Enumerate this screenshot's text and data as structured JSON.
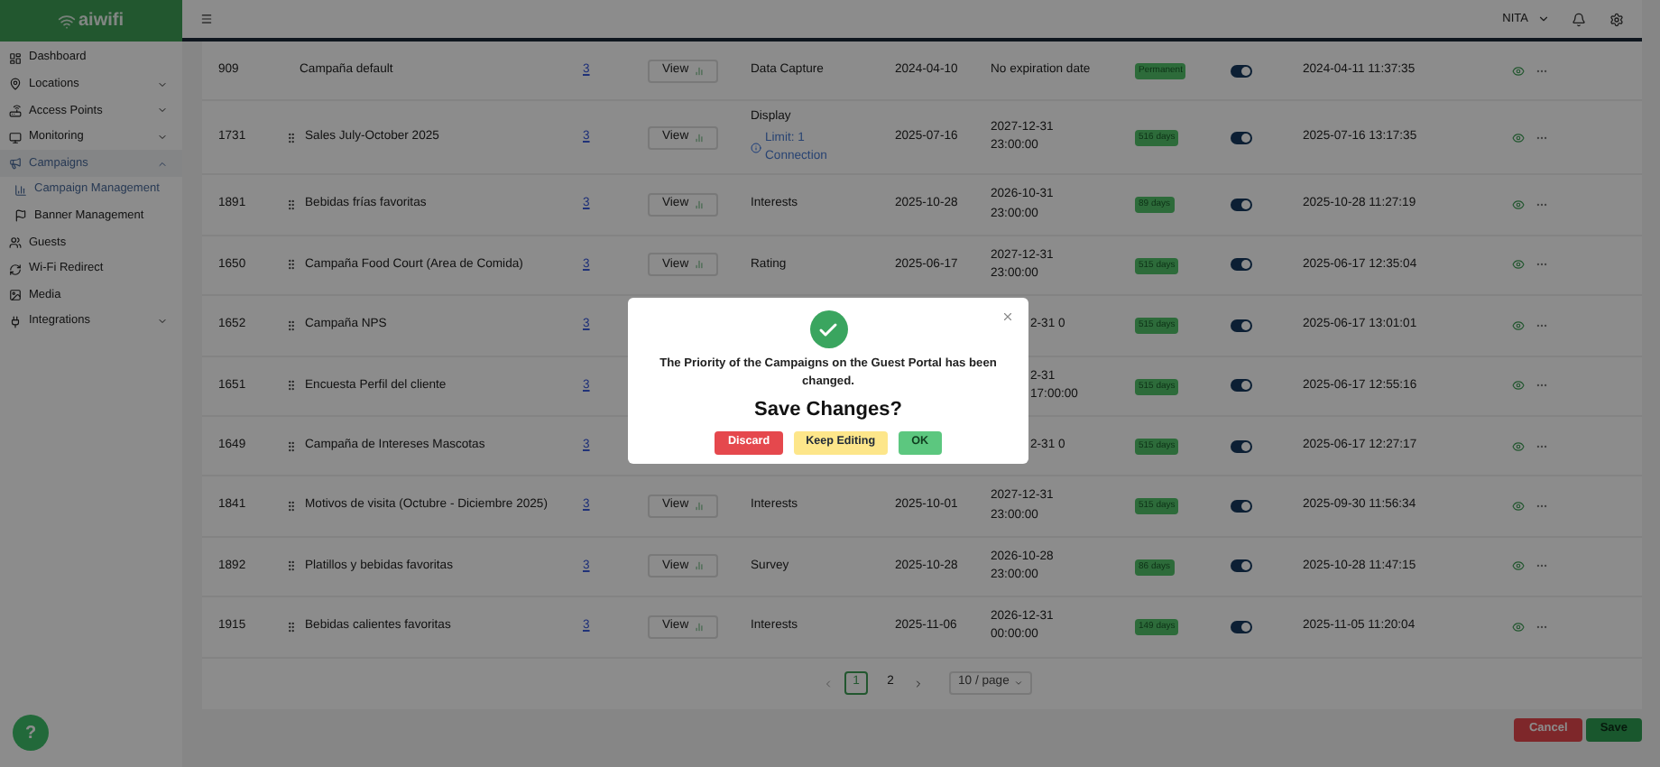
{
  "sidebar": {
    "logo": "aiwifi",
    "items": [
      {
        "label": "Dashboard",
        "kind": "link",
        "selected": false
      },
      {
        "label": "Locations",
        "kind": "group",
        "selected": false,
        "expanded": false
      },
      {
        "label": "Access Points",
        "kind": "group",
        "selected": false,
        "expanded": false
      },
      {
        "label": "Monitoring",
        "kind": "group",
        "selected": false,
        "expanded": false
      },
      {
        "label": "Campaigns",
        "kind": "group",
        "selected": true,
        "expanded": true,
        "children": [
          {
            "label": "Campaign Management",
            "selected": true
          },
          {
            "label": "Banner Management",
            "selected": false
          }
        ]
      },
      {
        "label": "Guests",
        "kind": "link",
        "selected": false
      },
      {
        "label": "Wi-Fi Redirect",
        "kind": "link",
        "selected": false
      },
      {
        "label": "Media",
        "kind": "link",
        "selected": false
      },
      {
        "label": "Integrations",
        "kind": "group",
        "selected": false,
        "expanded": false
      }
    ]
  },
  "header": {
    "user": "NITA"
  },
  "table": {
    "rows": [
      {
        "id": "909",
        "name": "Campaña default",
        "draggable": false,
        "count": "3",
        "view": "View",
        "type": "Data Capture",
        "start": "2024-04-10",
        "end": "No expiration date",
        "badge": "Permanent",
        "on": true,
        "updated": "2024-04-11 11:37:35"
      },
      {
        "id": "1731",
        "name": "Sales July-October 2025",
        "draggable": true,
        "count": "3",
        "view": "View",
        "type": "Display",
        "limit": "Limit: 1 Connection",
        "start": "2025-07-16",
        "end": "2027-12-31 23:00:00",
        "badge": "516 days",
        "on": true,
        "updated": "2025-07-16 13:17:35"
      },
      {
        "id": "1891",
        "name": "Bebidas frías favoritas",
        "draggable": true,
        "count": "3",
        "view": "View",
        "type": "Interests",
        "start": "2025-10-28",
        "end": "2026-10-31 23:00:00",
        "badge": "89 days",
        "on": true,
        "updated": "2025-10-28 11:27:19"
      },
      {
        "id": "1650",
        "name": "Campaña Food Court (Area de Comida)",
        "draggable": true,
        "count": "3",
        "view": "View",
        "type": "Rating",
        "start": "2025-06-17",
        "end": "2027-12-31 23:00:00",
        "badge": "515 days",
        "on": true,
        "updated": "2025-06-17 12:35:04"
      },
      {
        "id": "1652",
        "name": "Campaña NPS",
        "draggable": true,
        "count": "3",
        "end": "2-31 0",
        "badge": "515 days",
        "on": true,
        "updated": "2025-06-17 13:01:01"
      },
      {
        "id": "1651",
        "name": "Encuesta Perfil del cliente",
        "draggable": true,
        "count": "3",
        "end": "2-31 17:00:00",
        "badge": "515 days",
        "on": true,
        "updated": "2025-06-17 12:55:16"
      },
      {
        "id": "1649",
        "name": "Campaña de Intereses Mascotas",
        "draggable": true,
        "count": "3",
        "end": "2-31 0",
        "badge": "515 days",
        "on": true,
        "updated": "2025-06-17 12:27:17"
      },
      {
        "id": "1841",
        "name": "Motivos de visita (Octubre - Diciembre 2025)",
        "draggable": true,
        "count": "3",
        "view": "View",
        "type": "Interests",
        "start": "2025-10-01",
        "end": "2027-12-31 23:00:00",
        "badge": "515 days",
        "on": true,
        "updated": "2025-09-30 11:56:34"
      },
      {
        "id": "1892",
        "name": "Platillos y bebidas favoritas",
        "draggable": true,
        "count": "3",
        "view": "View",
        "type": "Survey",
        "start": "2025-10-28",
        "end": "2026-10-28 23:00:00",
        "badge": "86 days",
        "on": true,
        "updated": "2025-10-28 11:47:15"
      },
      {
        "id": "1915",
        "name": "Bebidas calientes favoritas",
        "draggable": true,
        "count": "3",
        "view": "View",
        "type": "Interests",
        "start": "2025-11-06",
        "end": "2026-12-31 00:00:00",
        "badge": "149 days",
        "on": true,
        "updated": "2025-11-05 11:20:04"
      }
    ]
  },
  "pagination": {
    "pages": [
      {
        "label": "1",
        "selected": true
      },
      {
        "label": "2",
        "selected": false
      }
    ],
    "page_size": "10 / page"
  },
  "footer_buttons": [
    {
      "label": "Cancel",
      "kind": "danger"
    },
    {
      "label": "Save",
      "kind": "primary"
    }
  ],
  "help_button": {
    "label": "?"
  },
  "dialog": {
    "message": "The Priority of the Campaigns on the Guest Portal has been changed.",
    "title": "Save Changes?",
    "buttons": [
      {
        "label": "Discard",
        "kind": "danger"
      },
      {
        "label": "Keep Editing",
        "kind": "warning"
      },
      {
        "label": "OK",
        "kind": "success"
      }
    ]
  }
}
